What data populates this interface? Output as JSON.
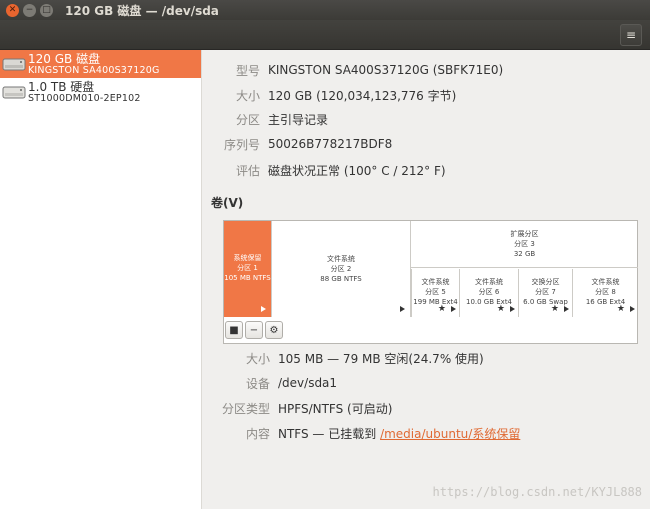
{
  "window": {
    "title": "120 GB 磁盘 — /dev/sda"
  },
  "header": {
    "menu_icon": "≡"
  },
  "sidebar": {
    "drives": [
      {
        "name": "120 GB 磁盘",
        "model": "KINGSTON SA400S37120G",
        "selected": true
      },
      {
        "name": "1.0 TB 硬盘",
        "model": "ST1000DM010-2EP102",
        "selected": false
      }
    ]
  },
  "drive_info": {
    "model_label": "型号",
    "model_value": "KINGSTON SA400S37120G (SBFK71E0)",
    "size_label": "大小",
    "size_value": "120 GB (120,034,123,776 字节)",
    "partitioning_label": "分区",
    "partitioning_value": "主引导记录",
    "serial_label": "序列号",
    "serial_value": "50026B778217BDF8",
    "assessment_label": "评估",
    "assessment_value": "磁盘状况正常 (100° C / 212° F)"
  },
  "volumes": {
    "heading": "卷(V)",
    "partitions": [
      {
        "line1": "系统保留",
        "line2": "分区 1",
        "line3": "105 MB NTFS"
      },
      {
        "line1": "文件系统",
        "line2": "分区 2",
        "line3": "88 GB NTFS"
      },
      {
        "line1": "扩展分区",
        "line2": "分区 3",
        "line3": "32 GB"
      },
      {
        "line1": "文件系统",
        "line2": "分区 5",
        "line3": "199 MB Ext4"
      },
      {
        "line1": "文件系统",
        "line2": "分区 6",
        "line3": "10.0 GB Ext4"
      },
      {
        "line1": "交换分区",
        "line2": "分区 7",
        "line3": "6.0 GB Swap"
      },
      {
        "line1": "文件系统",
        "line2": "分区 8",
        "line3": "16 GB Ext4"
      }
    ],
    "toolbar": {
      "stop_icon": "■",
      "minus_icon": "−",
      "gear_icon": "⚙"
    }
  },
  "volume_info": {
    "size_label": "大小",
    "size_value": "105 MB — 79 MB 空闲(24.7% 使用)",
    "device_label": "设备",
    "device_value": "/dev/sda1",
    "type_label": "分区类型",
    "type_value": "HPFS/NTFS (可启动)",
    "content_label": "内容",
    "content_prefix": "NTFS — 已挂载到 ",
    "content_link": "/media/ubuntu/系统保留"
  },
  "watermark": "https://blog.csdn.net/KYJL888",
  "colors": {
    "accent": "#f07746",
    "link": "#e06a33",
    "titlebar": "#3c3b37"
  }
}
